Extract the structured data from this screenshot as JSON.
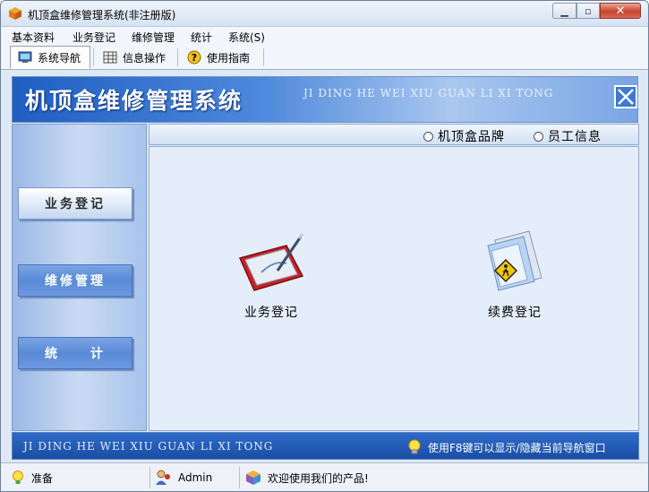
{
  "window": {
    "title": "机顶盒维修管理系统(非注册版)"
  },
  "menu": [
    "基本资料",
    "业务登记",
    "维修管理",
    "统计",
    "系统(S)"
  ],
  "toolbar": {
    "tabs": [
      "系统导航",
      "信息操作",
      "使用指南"
    ],
    "active_index": 0
  },
  "banner": {
    "title": "机顶盒维修管理系统",
    "subtitle": "JI DING HE WEI XIU GUAN LI XI TONG"
  },
  "nav": {
    "buttons": [
      "业务登记",
      "维修管理",
      "统　　计"
    ]
  },
  "content": {
    "radio_options": [
      "机顶盒品牌",
      "员工信息"
    ],
    "items": [
      "业务登记",
      "续费登记"
    ]
  },
  "footer": {
    "subtitle": "JI DING HE WEI XIU GUAN LI XI TONG",
    "hint": "使用F8键可以显示/隐藏当前导航窗口"
  },
  "status": {
    "state": "准备",
    "user": "Admin",
    "message": "欢迎使用我们的产品!"
  },
  "colors": {
    "banner_blue": "#1f5ec2",
    "content_bg": "#e4eefb",
    "close_red": "#c8432e"
  }
}
